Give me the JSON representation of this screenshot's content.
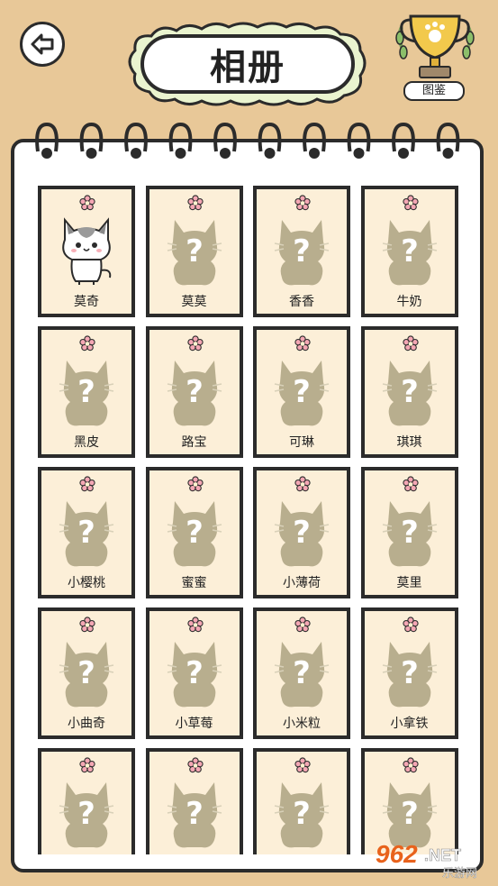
{
  "header": {
    "title": "相册",
    "encyclopedia_label": "图鉴"
  },
  "cards": [
    {
      "name": "莫奇",
      "unlocked": true
    },
    {
      "name": "莫莫",
      "unlocked": false
    },
    {
      "name": "香香",
      "unlocked": false
    },
    {
      "name": "牛奶",
      "unlocked": false
    },
    {
      "name": "黑皮",
      "unlocked": false
    },
    {
      "name": "路宝",
      "unlocked": false
    },
    {
      "name": "可琳",
      "unlocked": false
    },
    {
      "name": "琪琪",
      "unlocked": false
    },
    {
      "name": "小樱桃",
      "unlocked": false
    },
    {
      "name": "蜜蜜",
      "unlocked": false
    },
    {
      "name": "小薄荷",
      "unlocked": false
    },
    {
      "name": "莫里",
      "unlocked": false
    },
    {
      "name": "小曲奇",
      "unlocked": false
    },
    {
      "name": "小草莓",
      "unlocked": false
    },
    {
      "name": "小米粒",
      "unlocked": false
    },
    {
      "name": "小拿铁",
      "unlocked": false
    },
    {
      "name": "",
      "unlocked": false
    },
    {
      "name": "",
      "unlocked": false
    },
    {
      "name": "",
      "unlocked": false
    },
    {
      "name": "",
      "unlocked": false
    }
  ],
  "watermark": {
    "brand": "962",
    "suffix": ".NET",
    "sub": "乐游网"
  },
  "colors": {
    "background": "#e8c898",
    "card": "#fcefd8",
    "silhouette": "#b8ae8e",
    "outline": "#2b2b2b",
    "flower": "#f4a7b4"
  }
}
